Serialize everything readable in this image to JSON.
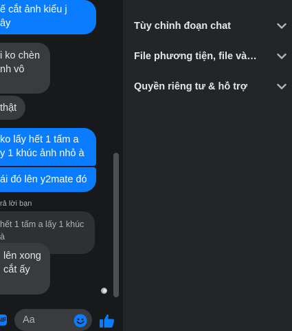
{
  "chat": {
    "messages": [
      {
        "dir": "out",
        "lines": [
          "ế cắt ảnh kiểu j",
          "ây"
        ]
      },
      {
        "dir": "in",
        "lines": [
          "i ko chèn",
          "nh vô"
        ]
      },
      {
        "dir": "in",
        "lines": [
          "thật"
        ]
      },
      {
        "dir": "out",
        "lines": [
          "ko lấy hết 1 tấm a",
          "y 1 khúc ảnh nhỏ à"
        ]
      },
      {
        "dir": "out",
        "lines": [
          "ái đó lên y2mate đó"
        ]
      },
      {
        "dir": "in",
        "lines": [
          "hết 1 tấm a lấy 1 khúc",
          "à"
        ]
      },
      {
        "dir": "in",
        "lines": [
          "lên xong",
          "cắt ấy"
        ]
      }
    ],
    "reply_note": "rả lời bạn",
    "composer": {
      "placeholder": "Aa",
      "value": ""
    },
    "icons": {
      "gif": "GIF",
      "emoji": "emoji-icon",
      "like": "thumbs-up-icon"
    }
  },
  "panel": {
    "top_fragment": "",
    "sections": [
      {
        "label": "Tùy chỉnh đoạn chat"
      },
      {
        "label": "File phương tiện, file và ..."
      },
      {
        "label": "Quyền riêng tư & hỗ trợ"
      }
    ]
  },
  "colors": {
    "accent": "#0a7cff",
    "bubble_in": "#3a3b3c",
    "bg_chat": "#18191a",
    "bg_panel": "#242526"
  }
}
